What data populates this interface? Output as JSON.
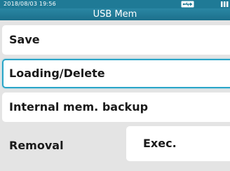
{
  "status_bar": {
    "datetime": "2018/08/03 19:56",
    "usb_icon": "usb-connected-icon",
    "battery_icon": "battery-icon"
  },
  "title_bar": {
    "title": "USB Mem"
  },
  "menu": {
    "items": [
      {
        "label": "Save"
      },
      {
        "label": "Loading/Delete",
        "selected": true
      },
      {
        "label": "Internal mem. backup"
      }
    ]
  },
  "removal": {
    "label": "Removal",
    "button_label": "Exec."
  },
  "colors": {
    "header": "#1f7a96",
    "selection_border": "#2aa5c8",
    "background": "#e4e4e4",
    "item_background": "#ffffff"
  }
}
